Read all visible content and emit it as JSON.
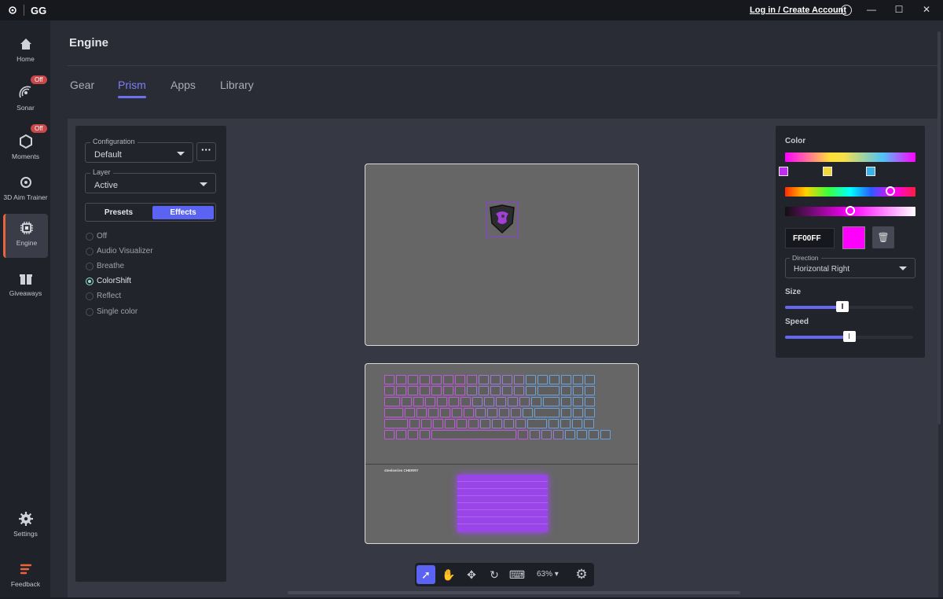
{
  "titlebar": {
    "logo": "GG",
    "login": "Log in / Create Account"
  },
  "sidebar": {
    "items": [
      {
        "label": "Home",
        "icon": "home-icon"
      },
      {
        "label": "Sonar",
        "icon": "sonar-icon",
        "badge": "Off"
      },
      {
        "label": "Moments",
        "icon": "moments-icon",
        "badge": "Off"
      },
      {
        "label": "3D Aim Trainer",
        "icon": "aim-icon"
      },
      {
        "label": "Engine",
        "icon": "engine-icon",
        "active": true
      },
      {
        "label": "Giveaways",
        "icon": "gift-icon"
      },
      {
        "label": "Settings",
        "icon": "gear-icon"
      },
      {
        "label": "Feedback",
        "icon": "feedback-icon"
      }
    ]
  },
  "page": {
    "title": "Engine"
  },
  "tabs": [
    "Gear",
    "Prism",
    "Apps",
    "Library"
  ],
  "active_tab": "Prism",
  "left_panel": {
    "configuration": {
      "label": "Configuration",
      "value": "Default"
    },
    "layer": {
      "label": "Layer",
      "value": "Active"
    },
    "segments": [
      "Presets",
      "Effects"
    ],
    "active_segment": "Effects",
    "effects": [
      "Off",
      "Audio Visualizer",
      "Breathe",
      "ColorShift",
      "Reflect",
      "Single color"
    ],
    "selected_effect": "ColorShift"
  },
  "device": {
    "keyboard_brand": "steelseries  CHERRY"
  },
  "toolbar": {
    "zoom": "63%"
  },
  "right_panel": {
    "color_title": "Color",
    "hex": "FF00FF",
    "hex_color": "#FF00FF",
    "direction": {
      "label": "Direction",
      "value": "Horizontal Right"
    },
    "size_label": "Size",
    "size_value": 0.45,
    "speed_label": "Speed",
    "speed_value": 0.5
  },
  "colors": {
    "accent": "#5b63f2",
    "badge": "#c9484a",
    "selected_radio": "#9be3cf"
  }
}
